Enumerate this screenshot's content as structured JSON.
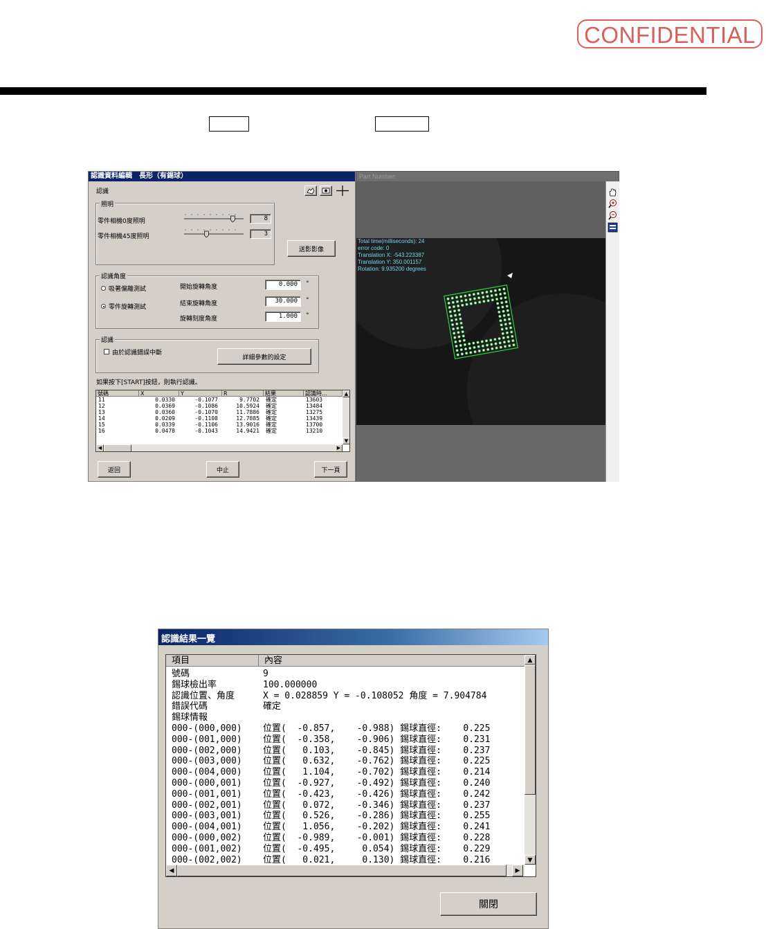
{
  "stamp": {
    "text": "CONFIDENTIAL",
    "color": "#d9605a"
  },
  "top_window": {
    "title": "認識資料編輯　長形（有錫球）",
    "section_label": "認識",
    "toolbar_icons": [
      "hand-icon",
      "camera-icon",
      "crosshair-icon"
    ],
    "lighting": {
      "group_label": "照明",
      "row1_label": "零件相機0度照明",
      "row1_value": "8",
      "row1_level": 0.9,
      "row2_label": "零件相機45度照明",
      "row2_value": "3",
      "row2_level": 0.4,
      "capture_button": "送影影像"
    },
    "angle": {
      "group_label": "認識角度",
      "radio1": "吸著偏離測試",
      "radio2": "零件旋轉測試",
      "selected": 2,
      "start_label": "開始旋轉角度",
      "start_value": "0.000",
      "end_label": "結束旋轉角度",
      "end_value": "30.000",
      "step_label": "旋轉刻度角度",
      "step_value": "1.000",
      "unit": "°"
    },
    "recog": {
      "group_label": "認識",
      "checkbox_label": "由於認識錯誤中斷",
      "detail_button": "詳細參數的設定"
    },
    "hint": "如果按下[START]按鈕，則執行認識。",
    "grid": {
      "headers": [
        "號碼",
        "X",
        "Y",
        "R",
        "結果",
        "認識時..."
      ],
      "rows": [
        [
          "11",
          "0.0330",
          "-0.1077",
          "9.7702",
          "確定",
          "13603"
        ],
        [
          "12",
          "0.0369",
          "-0.1086",
          "10.5924",
          "確定",
          "13484"
        ],
        [
          "13",
          "0.0360",
          "-0.1070",
          "11.7886",
          "確定",
          "13275"
        ],
        [
          "14",
          "0.0209",
          "-0.1108",
          "12.7885",
          "確定",
          "13439"
        ],
        [
          "15",
          "0.0339",
          "-0.1106",
          "13.9016",
          "確定",
          "13700"
        ],
        [
          "16",
          "0.0478",
          "-0.1043",
          "14.9421",
          "確定",
          "13210"
        ]
      ]
    },
    "buttons": {
      "back": "返回",
      "stop": "中止",
      "next": "下一頁"
    }
  },
  "viewer": {
    "title": "Part Number:",
    "overlay": [
      "Total time(milliseconds): 24",
      "error code: 0",
      "Translation X: -543.223387",
      "Translation Y: 350.001157",
      "Rotation: 9.935200 degrees"
    ],
    "side_icons": [
      "hand-icon",
      "zoom-in-icon",
      "zoom-out-icon",
      "fit-icon"
    ],
    "part_rotation_deg": 9.94,
    "accent": "#27d23a"
  },
  "result_dialog": {
    "title": "認識結果一覽",
    "headers": [
      "項目",
      "內容"
    ],
    "rows": [
      [
        "號碼",
        "9"
      ],
      [
        "錫球檢出率",
        "100.000000"
      ],
      [
        "認識位置、角度",
        "X = 0.028859 Y = -0.108052 角度 = 7.904784"
      ],
      [
        "錯誤代碼",
        "確定"
      ],
      [
        "錫球情報",
        ""
      ],
      [
        "000-(000,000)",
        "位置(  -0.857,    -0.988) 錫球直徑:    0.225"
      ],
      [
        "000-(001,000)",
        "位置(  -0.358,    -0.906) 錫球直徑:    0.231"
      ],
      [
        "000-(002,000)",
        "位置(   0.103,    -0.845) 錫球直徑:    0.237"
      ],
      [
        "000-(003,000)",
        "位置(   0.632,    -0.762) 錫球直徑:    0.225"
      ],
      [
        "000-(004,000)",
        "位置(   1.104,    -0.702) 錫球直徑:    0.214"
      ],
      [
        "000-(000,001)",
        "位置(  -0.927,    -0.492) 錫球直徑:    0.240"
      ],
      [
        "000-(001,001)",
        "位置(  -0.423,    -0.426) 錫球直徑:    0.242"
      ],
      [
        "000-(002,001)",
        "位置(   0.072,    -0.346) 錫球直徑:    0.237"
      ],
      [
        "000-(003,001)",
        "位置(   0.526,    -0.286) 錫球直徑:    0.255"
      ],
      [
        "000-(004,001)",
        "位置(   1.056,    -0.202) 錫球直徑:    0.241"
      ],
      [
        "000-(000,002)",
        "位置(  -0.989,    -0.001) 錫球直徑:    0.228"
      ],
      [
        "000-(001,002)",
        "位置(  -0.495,     0.054) 錫球直徑:    0.229"
      ],
      [
        "000-(002,002)",
        "位置(   0.021,     0.130) 錫球直徑:    0.216"
      ]
    ],
    "close_button": "關閉"
  }
}
